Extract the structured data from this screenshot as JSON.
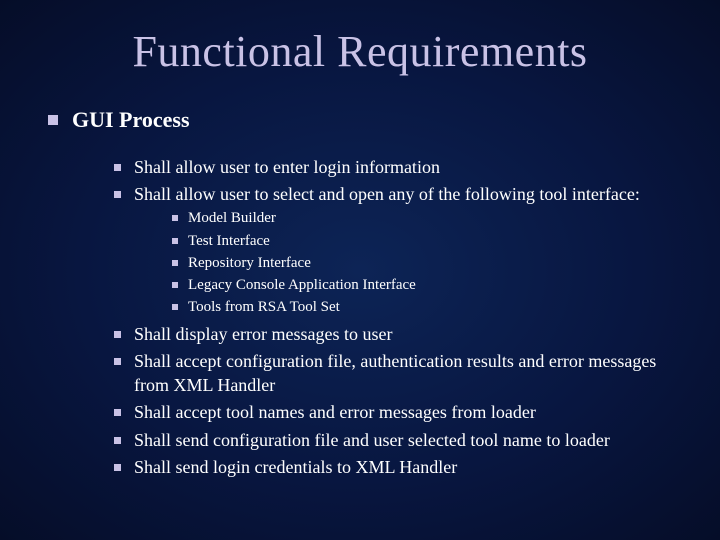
{
  "title": "Functional Requirements",
  "section": "GUI Process",
  "items_top": [
    "Shall allow user to enter login information",
    "Shall allow user to select and open any of the following tool interface:"
  ],
  "tools": [
    "Model Builder",
    "Test Interface",
    "Repository Interface",
    "Legacy Console Application Interface",
    "Tools from RSA Tool Set"
  ],
  "items_bottom": [
    "Shall display error messages to user",
    "Shall accept configuration file, authentication results and error messages from XML Handler",
    "Shall accept tool names and error messages from loader",
    "Shall send configuration file and user selected tool name to loader",
    "Shall send login credentials to XML Handler"
  ]
}
